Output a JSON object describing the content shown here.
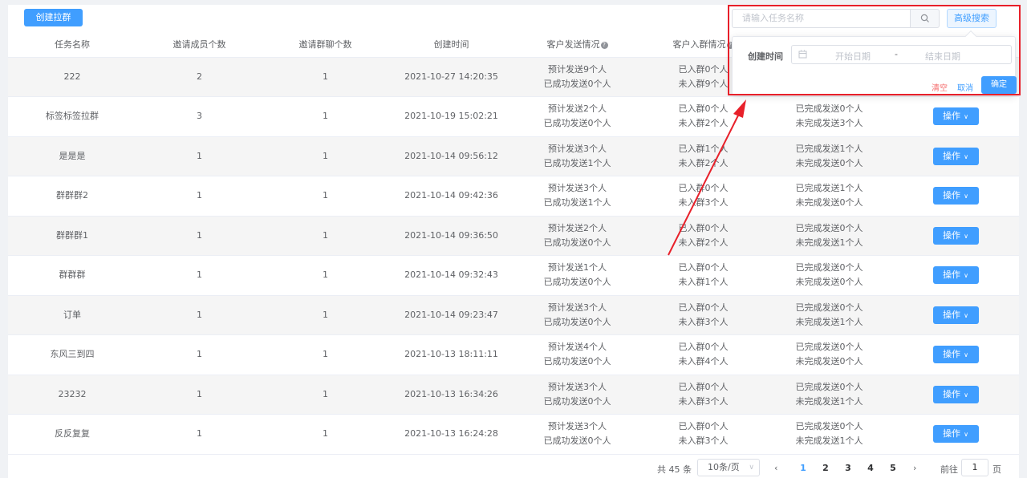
{
  "toolbar": {
    "create_label": "创建拉群"
  },
  "table": {
    "headers": [
      "任务名称",
      "邀请成员个数",
      "邀请群聊个数",
      "创建时间",
      "客户发送情况",
      "客户入群情况",
      "",
      ""
    ],
    "rows": [
      {
        "name": "222",
        "members": "2",
        "groups": "1",
        "created": "2021-10-27 14:20:35",
        "send1": "预计发送9个人",
        "send2": "已成功发送0个人",
        "join1": "已入群0个人",
        "join2": "未入群9个人",
        "done1": "",
        "done2": ""
      },
      {
        "name": "标签标签拉群",
        "members": "3",
        "groups": "1",
        "created": "2021-10-19 15:02:21",
        "send1": "预计发送2个人",
        "send2": "已成功发送0个人",
        "join1": "已入群0个人",
        "join2": "未入群2个人",
        "done1": "已完成发送0个人",
        "done2": "未完成发送3个人"
      },
      {
        "name": "是是是",
        "members": "1",
        "groups": "1",
        "created": "2021-10-14 09:56:12",
        "send1": "预计发送3个人",
        "send2": "已成功发送1个人",
        "join1": "已入群1个人",
        "join2": "未入群2个人",
        "done1": "已完成发送1个人",
        "done2": "未完成发送0个人"
      },
      {
        "name": "群群群2",
        "members": "1",
        "groups": "1",
        "created": "2021-10-14 09:42:36",
        "send1": "预计发送3个人",
        "send2": "已成功发送1个人",
        "join1": "已入群0个人",
        "join2": "未入群3个人",
        "done1": "已完成发送1个人",
        "done2": "未完成发送0个人"
      },
      {
        "name": "群群群1",
        "members": "1",
        "groups": "1",
        "created": "2021-10-14 09:36:50",
        "send1": "预计发送2个人",
        "send2": "已成功发送0个人",
        "join1": "已入群0个人",
        "join2": "未入群2个人",
        "done1": "已完成发送0个人",
        "done2": "未完成发送1个人"
      },
      {
        "name": "群群群",
        "members": "1",
        "groups": "1",
        "created": "2021-10-14 09:32:43",
        "send1": "预计发送1个人",
        "send2": "已成功发送0个人",
        "join1": "已入群0个人",
        "join2": "未入群1个人",
        "done1": "已完成发送0个人",
        "done2": "未完成发送0个人"
      },
      {
        "name": "订单",
        "members": "1",
        "groups": "1",
        "created": "2021-10-14 09:23:47",
        "send1": "预计发送3个人",
        "send2": "已成功发送0个人",
        "join1": "已入群0个人",
        "join2": "未入群3个人",
        "done1": "已完成发送0个人",
        "done2": "未完成发送1个人"
      },
      {
        "name": "东风三到四",
        "members": "1",
        "groups": "1",
        "created": "2021-10-13 18:11:11",
        "send1": "预计发送4个人",
        "send2": "已成功发送0个人",
        "join1": "已入群0个人",
        "join2": "未入群4个人",
        "done1": "已完成发送0个人",
        "done2": "未完成发送0个人"
      },
      {
        "name": "23232",
        "members": "1",
        "groups": "1",
        "created": "2021-10-13 16:34:26",
        "send1": "预计发送3个人",
        "send2": "已成功发送0个人",
        "join1": "已入群0个人",
        "join2": "未入群3个人",
        "done1": "已完成发送0个人",
        "done2": "未完成发送1个人"
      },
      {
        "name": "反反复复",
        "members": "1",
        "groups": "1",
        "created": "2021-10-13 16:24:28",
        "send1": "预计发送3个人",
        "send2": "已成功发送0个人",
        "join1": "已入群0个人",
        "join2": "未入群3个人",
        "done1": "已完成发送0个人",
        "done2": "未完成发送1个人"
      }
    ],
    "action_label": "操作"
  },
  "pagination": {
    "total": "共 45 条",
    "page_size": "10条/页",
    "pages": [
      "1",
      "2",
      "3",
      "4",
      "5"
    ],
    "current": "1",
    "goto_label": "前往",
    "goto_value": "1",
    "goto_unit": "页",
    "prev_icon": "‹",
    "next_icon": "›"
  },
  "search": {
    "placeholder": "请输入任务名称",
    "advanced_label": "高级搜索"
  },
  "popover": {
    "label": "创建时间",
    "start_placeholder": "开始日期",
    "separator": "-",
    "end_placeholder": "结束日期",
    "clear_label": "清空",
    "cancel_label": "取消",
    "confirm_label": "确定"
  },
  "colors": {
    "primary": "#409eff",
    "danger": "#f56c6c",
    "annotation": "#e8202a"
  },
  "icons": {
    "search": "search-icon",
    "calendar": "calendar-icon",
    "help": "help-icon",
    "chevron": "chevron-down-icon"
  }
}
